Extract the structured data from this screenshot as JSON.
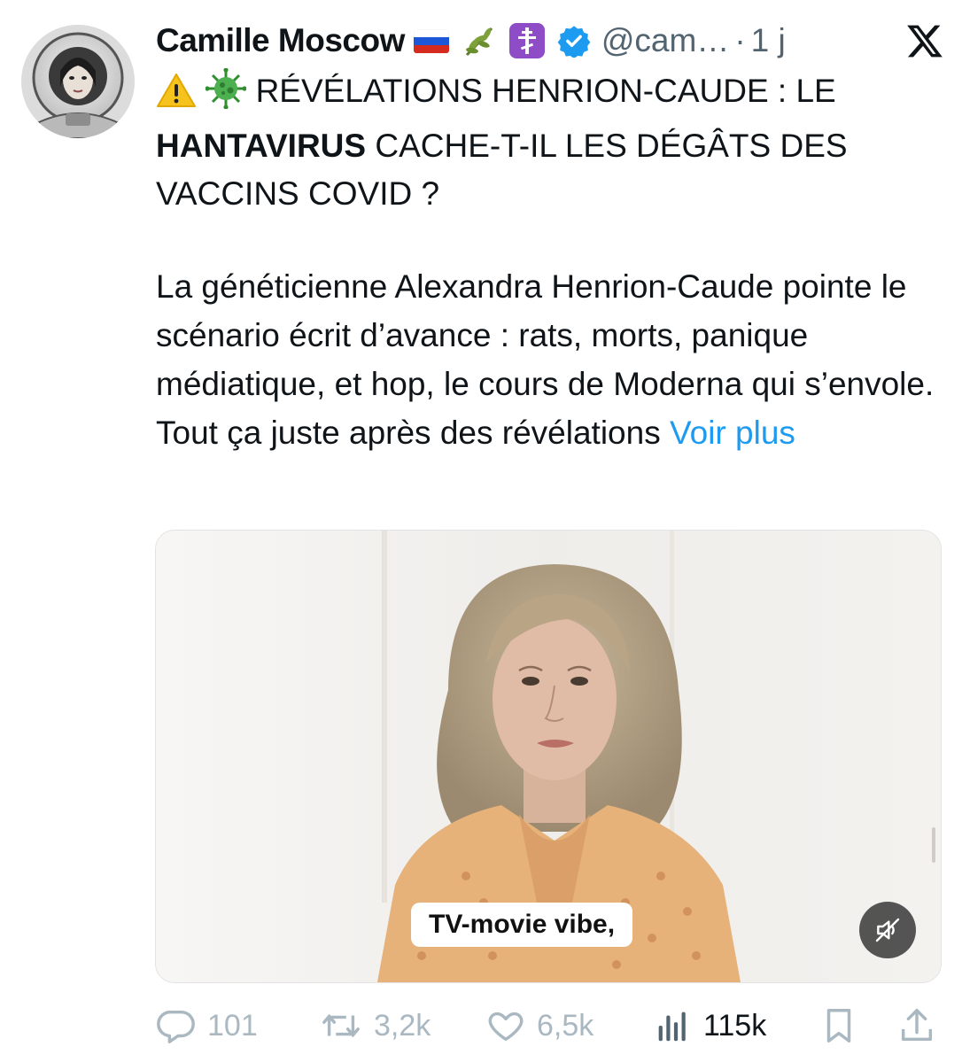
{
  "author": {
    "display_name": "Camille Moscow",
    "handle": "@cam…",
    "separator": "·",
    "time": "1 j",
    "badges": [
      "russia-flag",
      "olive-branch-emoji",
      "orthodox-cross-emoji",
      "verified-badge-icon"
    ]
  },
  "headline": {
    "emojis": [
      "warning-emoji",
      "virus-emoji"
    ],
    "part1": "RÉVÉLATIONS HENRION-CAUDE : LE",
    "bold": "HANTAVIRUS",
    "part2": "CACHE-T-IL LES DÉGÂTS DES VACCINS COVID ?"
  },
  "body": {
    "text": "La généticienne Alexandra Henrion-Caude pointe le scénario écrit d’avance : rats, morts, panique médiatique, et hop, le cours de Moderna qui s’envole. Tout ça juste après des révélations",
    "more_link": "Voir plus"
  },
  "media": {
    "subtitle": "TV-movie vibe,",
    "muted": true
  },
  "actions": {
    "replies": "101",
    "reposts": "3,2k",
    "likes": "6,5k",
    "views": "115k"
  },
  "colors": {
    "link": "#1d9bf0",
    "muted_text": "#536471",
    "verified": "#1d9bf0",
    "action_icons": "#aab8c2"
  }
}
